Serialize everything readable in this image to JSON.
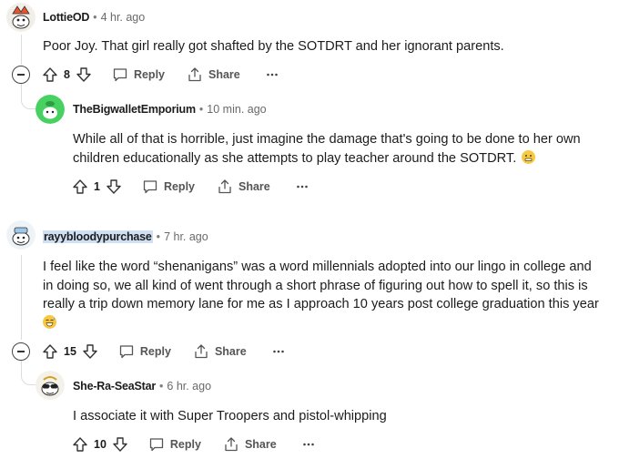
{
  "comments": [
    {
      "username": "LottieOD",
      "time": "4 hr. ago",
      "body": "Poor Joy. That girl really got shafted by the SOTDRT and her ignorant parents.",
      "votes": "8",
      "reply_label": "Reply",
      "share_label": "Share"
    },
    {
      "username": "TheBigwalletEmporium",
      "time": "10 min. ago",
      "body": "While all of that is horrible, just imagine the damage that's going to be done to her own children educationally as she attempts to play teacher around the SOTDRT.",
      "emoji": "grimace-emoji",
      "votes": "1",
      "reply_label": "Reply",
      "share_label": "Share"
    },
    {
      "username": "rayybloodypurchase",
      "time": "7 hr. ago",
      "body": "I feel like the word “shenanigans” was a word millennials adopted into our lingo in college and in doing so, we all kind of went through a short phrase of figuring out how to spell it, so this is really a trip down memory lane for me as I approach 10 years post college graduation this year",
      "emoji": "grin-sweat-emoji",
      "votes": "15",
      "reply_label": "Reply",
      "share_label": "Share"
    },
    {
      "username": "She-Ra-SeaStar",
      "time": "6 hr. ago",
      "body": "I associate it with Super Troopers and pistol-whipping",
      "votes": "10",
      "reply_label": "Reply",
      "share_label": "Share"
    }
  ],
  "separator": "•",
  "icons": {
    "upvote": "upvote-arrow-icon",
    "downvote": "downvote-arrow-icon",
    "reply": "speech-bubble-icon",
    "share": "share-upload-icon",
    "more": "more-dots-icon",
    "collapse": "collapse-minus-icon"
  },
  "colors": {
    "username_highlight": "#cfe0f4",
    "thread_line": "#dcdcdc",
    "text": "#1c1c1c",
    "muted": "#6a6a6a"
  }
}
